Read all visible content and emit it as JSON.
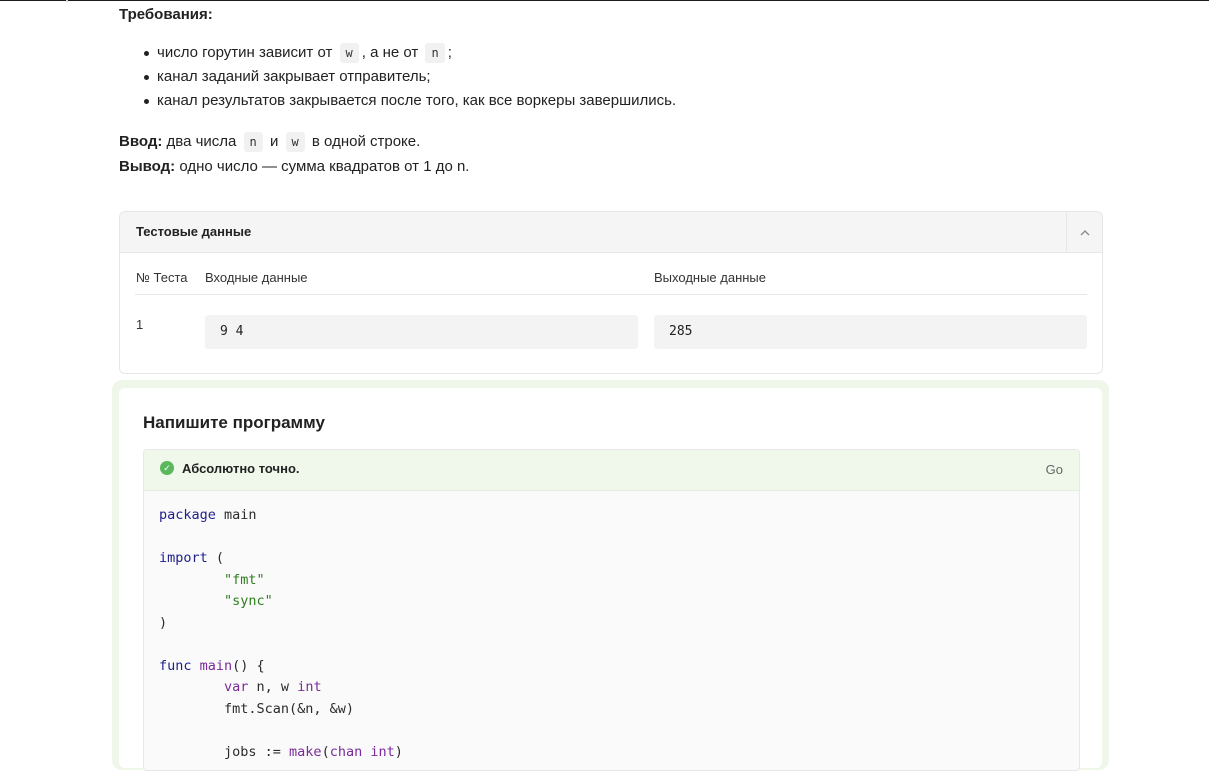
{
  "requirements": {
    "title": "Требования:",
    "item1": {
      "before": "число горутин зависит от",
      "code1": "w",
      "middle": ", а не от",
      "code2": "n",
      "after": ";"
    },
    "item2": "канал заданий закрывает отправитель;",
    "item3": "канал результатов закрывается после того, как все воркеры завершились."
  },
  "io": {
    "input_label": "Ввод:",
    "input_before": "два числа",
    "input_code1": "n",
    "input_and": "и",
    "input_code2": "w",
    "input_after": "в одной строке.",
    "output_label": "Вывод:",
    "output_text": "одно число — сумма квадратов от 1 до n."
  },
  "tests": {
    "title": "Тестовые данные",
    "toggle_icon": "chevron-up-icon",
    "columns": [
      "№ Теста",
      "Входные данные",
      "Выходные данные"
    ],
    "rows": [
      {
        "num": "1",
        "input": "9 4",
        "output": "285"
      }
    ]
  },
  "program": {
    "title": "Напишите программу",
    "status": "Абсолютно точно.",
    "status_color": "#5cb85c",
    "language": "Go",
    "code_lines": [
      "package main",
      "",
      "import (",
      "        \"fmt\"",
      "        \"sync\"",
      ")",
      "",
      "func main() {",
      "        var n, w int",
      "        fmt.Scan(&n, &w)",
      "",
      "        jobs := make(chan int)"
    ]
  }
}
